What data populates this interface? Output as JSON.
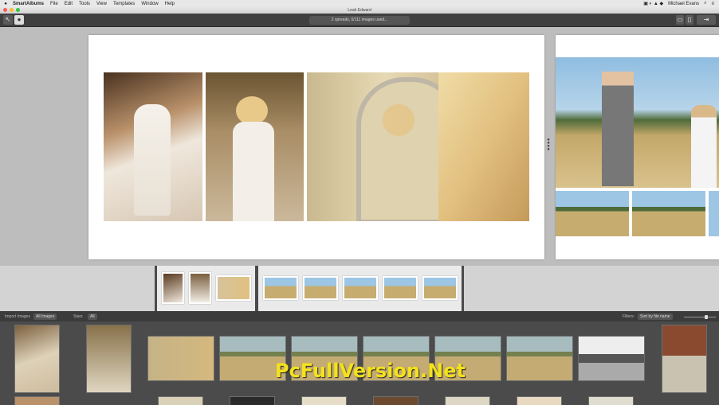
{
  "menubar": {
    "app_name": "SmartAlbums",
    "items": [
      "File",
      "Edit",
      "Tools",
      "View",
      "Templates",
      "Window",
      "Help"
    ],
    "user": "Michael Evans"
  },
  "window": {
    "title": "Leah Edward"
  },
  "toolbar": {
    "status": "2 spreads, 0/111 images used..."
  },
  "filterbar": {
    "import_label": "Import Images",
    "images_select": "All Images",
    "stars_label": "Stars",
    "stars_select": "All",
    "filters_label": "Filters:",
    "sort_select": "Sort by file name"
  },
  "watermark": "PcFullVersion.Net",
  "colors": {
    "menubar": "#e8e8e8",
    "canvas": "#bdbdbd",
    "gallery": "#4b4b4b",
    "watermark": "#f3e21c"
  }
}
